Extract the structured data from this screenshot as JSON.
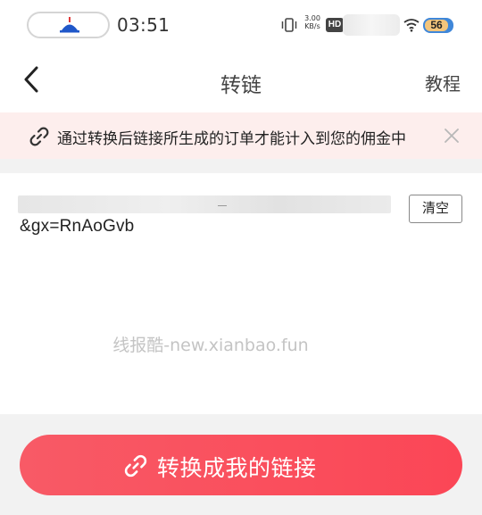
{
  "status_bar": {
    "time": "03:51",
    "speed_value": "3.00",
    "speed_unit": "KB/s",
    "hd_label": "HD",
    "battery": "56"
  },
  "navbar": {
    "title": "转链",
    "right_link": "教程"
  },
  "notice": {
    "text": "通过转换后链接所生成的订单才能计入到您的佣金中"
  },
  "input": {
    "link_tail": "&gx=RnAoGvb",
    "clear_label": "清空"
  },
  "watermark": "线报酷-new.xianbao.fun",
  "action": {
    "convert_label": "转换成我的链接"
  },
  "colors": {
    "accent": "#fb4656",
    "notice_bg": "#fdeeed",
    "battery_blue": "#3f87d9"
  }
}
